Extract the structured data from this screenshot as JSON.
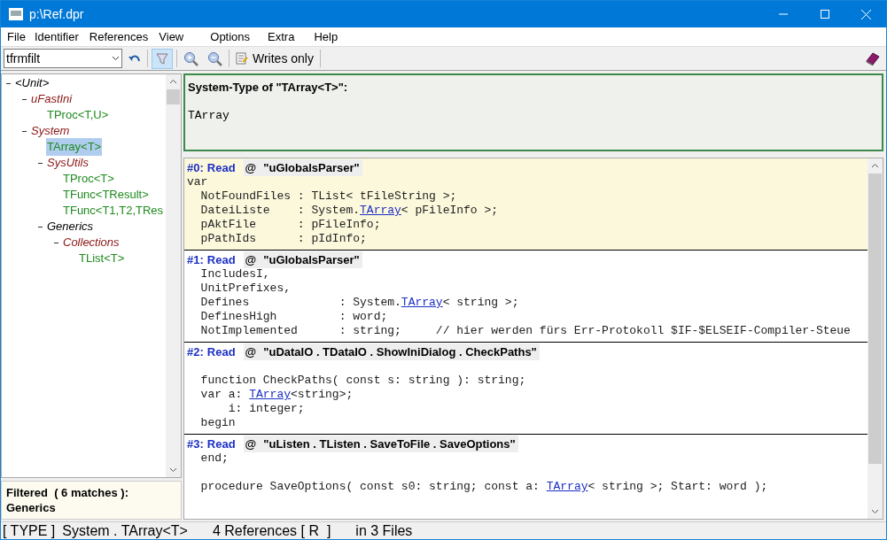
{
  "window": {
    "title": "p:\\Ref.dpr"
  },
  "menu": [
    "File",
    "Identifier",
    "References",
    "View",
    "Options",
    "Extra",
    "Help"
  ],
  "toolbar": {
    "combo_value": "tfrmfilt",
    "filter_on": true,
    "writes_only_label": "Writes only"
  },
  "tree": [
    {
      "label": "<Unit>",
      "kind": "namespace",
      "expanded": true,
      "selected": false,
      "children": [
        {
          "label": "uFastIni",
          "kind": "unit",
          "expanded": true,
          "selected": false,
          "children": [
            {
              "label": "TProc<T,U>",
              "kind": "type",
              "selected": false
            }
          ]
        },
        {
          "label": "System",
          "kind": "unit",
          "expanded": true,
          "selected": false,
          "children": [
            {
              "label": "TArray<T>",
              "kind": "type",
              "selected": true
            },
            {
              "label": "SysUtils",
              "kind": "unit",
              "expanded": true,
              "selected": false,
              "children": [
                {
                  "label": "TProc<T>",
                  "kind": "type",
                  "selected": false
                },
                {
                  "label": "TFunc<TResult>",
                  "kind": "type",
                  "selected": false
                },
                {
                  "label": "TFunc<T1,T2,TRes",
                  "kind": "type",
                  "selected": false
                }
              ]
            },
            {
              "label": "Generics",
              "kind": "namespace",
              "expanded": true,
              "selected": false,
              "children": [
                {
                  "label": "Collections",
                  "kind": "unit",
                  "expanded": true,
                  "selected": false,
                  "children": [
                    {
                      "label": "TList<T>",
                      "kind": "type",
                      "selected": false
                    }
                  ]
                }
              ]
            }
          ]
        }
      ]
    }
  ],
  "filter_info": {
    "title": "Filtered  ( 6 matches ):",
    "value": "Generics"
  },
  "type_box": {
    "title": "System-Type of \"TArray<T>\":",
    "value": "TArray"
  },
  "references": [
    {
      "index": "#0:",
      "action": "Read",
      "at": "@",
      "location": "\"uGlobalsParser\"",
      "selected": true,
      "lines": [
        [
          {
            "kind": "code",
            "text": "var"
          }
        ],
        [
          {
            "kind": "code",
            "text": "  NotFoundFiles : TList< tFileString >;"
          }
        ],
        [
          {
            "kind": "code",
            "text": "  DateiListe    : System."
          },
          {
            "kind": "link",
            "text": "TArray"
          },
          {
            "kind": "code",
            "text": "< pFileInfo >;"
          }
        ],
        [
          {
            "kind": "code",
            "text": "  pAktFile      : pFileInfo;"
          }
        ],
        [
          {
            "kind": "code",
            "text": "  pPathIds      : pIdInfo;"
          }
        ]
      ]
    },
    {
      "index": "#1:",
      "action": "Read",
      "at": "@",
      "location": "\"uGlobalsParser\"",
      "selected": false,
      "lines": [
        [
          {
            "kind": "code",
            "text": "  IncludesI,"
          }
        ],
        [
          {
            "kind": "code",
            "text": "  UnitPrefixes,"
          }
        ],
        [
          {
            "kind": "code",
            "text": "  Defines             : System."
          },
          {
            "kind": "link",
            "text": "TArray"
          },
          {
            "kind": "code",
            "text": "< string >;"
          }
        ],
        [
          {
            "kind": "code",
            "text": "  DefinesHigh         : word;"
          }
        ],
        [
          {
            "kind": "code",
            "text": "  NotImplemented      : string;     // hier werden fürs Err-Protokoll $IF-$ELSEIF-Compiler-Steue"
          }
        ]
      ]
    },
    {
      "index": "#2:",
      "action": "Read",
      "at": "@",
      "location": "\"uDataIO . TDataIO . ShowIniDialog . CheckPaths\"",
      "selected": false,
      "lines": [
        {
          "kind": "blank"
        },
        [
          {
            "kind": "code",
            "text": "  function CheckPaths( const s: string ): string;"
          }
        ],
        [
          {
            "kind": "code",
            "text": "  var a: "
          },
          {
            "kind": "link",
            "text": "TArray"
          },
          {
            "kind": "code",
            "text": "<string>;"
          }
        ],
        [
          {
            "kind": "code",
            "text": "      i: integer;"
          }
        ],
        [
          {
            "kind": "code",
            "text": "  begin"
          }
        ]
      ]
    },
    {
      "index": "#3:",
      "action": "Read",
      "at": "@",
      "location": "\"uListen . TListen . SaveToFile . SaveOptions\"",
      "selected": false,
      "lines": [
        [
          {
            "kind": "code",
            "text": "  end;"
          }
        ],
        {
          "kind": "blank"
        },
        [
          {
            "kind": "code",
            "text": "  procedure SaveOptions( const s0: string; const a: "
          },
          {
            "kind": "link",
            "text": "TArray"
          },
          {
            "kind": "code",
            "text": "< string >; Start: word );"
          }
        ]
      ]
    }
  ],
  "status_bar": [
    "[ TYPE ]",
    "System . TArray<T>",
    "4 References [ R  ]",
    "in 3 Files"
  ]
}
